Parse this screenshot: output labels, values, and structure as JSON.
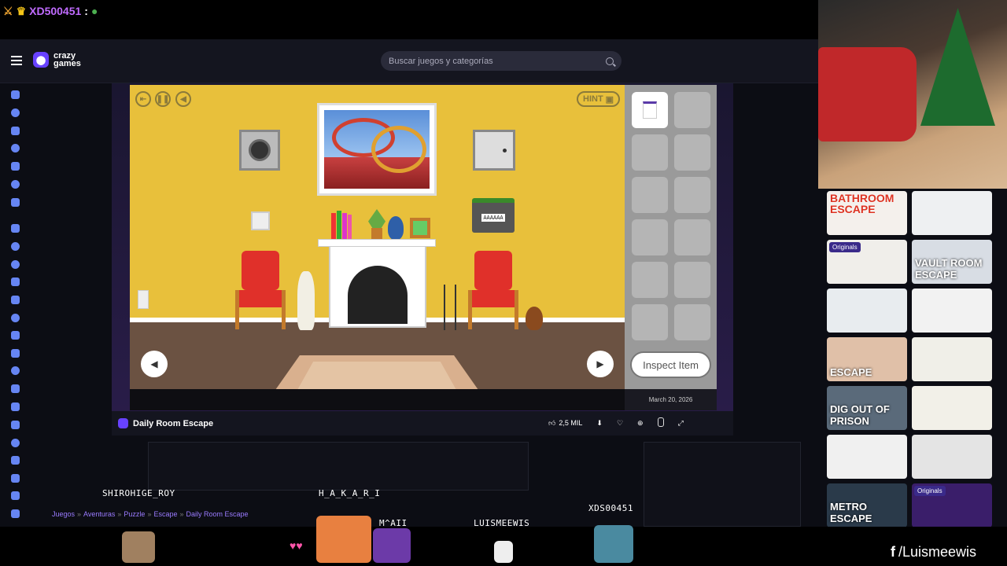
{
  "stream": {
    "chat_user": "XD500451",
    "chat_sep": ":",
    "social": "/Luismeewis",
    "viewers": [
      "SHIROHIGE_ROY",
      "H_A_K_A_R_I",
      "M^AII",
      "LUISMEEWIS",
      "XDS00451"
    ]
  },
  "header": {
    "logo_line1": "crazy",
    "logo_line2": "games",
    "search_placeholder": "Buscar juegos y categorías"
  },
  "game": {
    "title": "Daily Room Escape",
    "hint_label": "HINT",
    "inspect_label": "Inspect Item",
    "date": "March 20, 2026",
    "likes": "2,5 MIL",
    "lock_code": "AAAAAA"
  },
  "breadcrumb": [
    "Juegos",
    "Aventuras",
    "Puzzle",
    "Escape",
    "Daily Room Escape"
  ],
  "thumbs": [
    {
      "label": "BATHROOM ESCAPE",
      "badge": ""
    },
    {
      "label": "",
      "badge": ""
    },
    {
      "label": "",
      "badge": "Originals"
    },
    {
      "label": "VAULT ROOM ESCAPE",
      "badge": ""
    },
    {
      "label": "",
      "badge": ""
    },
    {
      "label": "",
      "badge": ""
    },
    {
      "label": "ESCAPE",
      "badge": ""
    },
    {
      "label": "",
      "badge": ""
    },
    {
      "label": "DIG OUT OF PRISON",
      "badge": ""
    },
    {
      "label": "",
      "badge": ""
    },
    {
      "label": "",
      "badge": ""
    },
    {
      "label": "",
      "badge": ""
    },
    {
      "label": "METRO ESCAPE",
      "badge": ""
    },
    {
      "label": "",
      "badge": "Originals"
    }
  ],
  "colors": {
    "accent": "#6842ff",
    "wall": "#e8c03b",
    "floor": "#6b5242"
  }
}
